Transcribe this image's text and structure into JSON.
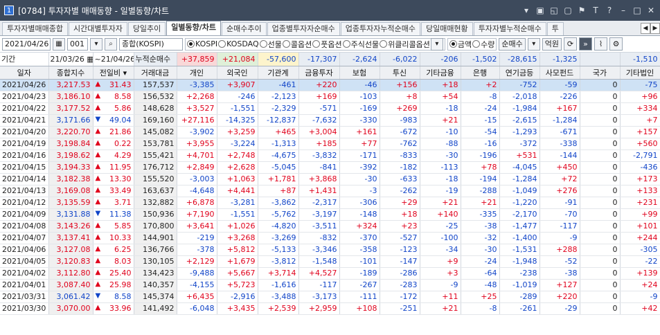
{
  "window": {
    "badge": "1",
    "title": "[0784] 투자자별 매매동향 - 일별동향/차트"
  },
  "tabs": [
    "투자자별매매종합",
    "시간대별투자자",
    "당일추이",
    "일별동향/차트",
    "순매수추이",
    "업종별투자자순매수",
    "업종투자자누적순매수",
    "당일매매현황",
    "투자자별누적순매수",
    "투"
  ],
  "active_tab": 3,
  "toolbar": {
    "date": "2021/04/26",
    "code": "001",
    "market_name": "종합(KOSPI)",
    "market_options": [
      "KOSPI",
      "KOSDAQ",
      "선물",
      "콜옵션",
      "풋옵션",
      "주식선물",
      "위클리콜옵션"
    ],
    "value_options": [
      "금액",
      "수량"
    ],
    "net_buy": "순매수",
    "unit": "억원"
  },
  "period": {
    "label": "기간",
    "from": "21/03/26",
    "sep": "~",
    "to": "21/04/26",
    "sum_label": "누적순매수",
    "sums": [
      "+37,859",
      "+21,084",
      "-57,600",
      "-17,307",
      "-2,624",
      "-6,022",
      "-206",
      "-1,502",
      "-28,615",
      "-1,325",
      "",
      "-1,510"
    ]
  },
  "columns": [
    "일자",
    "종합지수",
    "전일비",
    "거래대금",
    "개인",
    "외국인",
    "기관계",
    "금융투자",
    "보험",
    "투신",
    "기타금융",
    "은행",
    "연기금등",
    "사모펀드",
    "국가",
    "기타법인"
  ],
  "rows": [
    [
      "2021/04/26",
      "3,217.53",
      "up",
      "31.43",
      "157,537",
      "-3,385",
      "+3,907",
      "-461",
      "+220",
      "-46",
      "+156",
      "+18",
      "+2",
      "-752",
      "-59",
      "0",
      "-75"
    ],
    [
      "2021/04/23",
      "3,186.10",
      "up",
      "8.58",
      "156,532",
      "+2,268",
      "-246",
      "-2,123",
      "+169",
      "-103",
      "+8",
      "+54",
      "-8",
      "-2,018",
      "-226",
      "0",
      "+96"
    ],
    [
      "2021/04/22",
      "3,177.52",
      "up",
      "5.86",
      "148,628",
      "+3,527",
      "-1,551",
      "-2,329",
      "-571",
      "-169",
      "+269",
      "-18",
      "-24",
      "-1,984",
      "+167",
      "0",
      "+334"
    ],
    [
      "2021/04/21",
      "3,171.66",
      "dn",
      "49.04",
      "169,160",
      "+27,116",
      "-14,325",
      "-12,837",
      "-7,632",
      "-330",
      "-983",
      "+21",
      "-15",
      "-2,615",
      "-1,284",
      "0",
      "+7"
    ],
    [
      "2021/04/20",
      "3,220.70",
      "up",
      "21.86",
      "145,082",
      "-3,902",
      "+3,259",
      "+465",
      "+3,004",
      "+161",
      "-672",
      "-10",
      "-54",
      "-1,293",
      "-671",
      "0",
      "+157"
    ],
    [
      "2021/04/19",
      "3,198.84",
      "up",
      "0.22",
      "153,781",
      "+3,955",
      "-3,224",
      "-1,313",
      "+185",
      "+77",
      "-762",
      "-88",
      "-16",
      "-372",
      "-338",
      "0",
      "+560"
    ],
    [
      "2021/04/16",
      "3,198.62",
      "up",
      "4.29",
      "155,421",
      "+4,701",
      "+2,748",
      "-4,675",
      "-3,832",
      "-171",
      "-833",
      "-30",
      "-196",
      "+531",
      "-144",
      "0",
      "-2,791"
    ],
    [
      "2021/04/15",
      "3,194.33",
      "up",
      "11.95",
      "176,712",
      "+2,849",
      "+2,628",
      "-5,045",
      "-841",
      "-392",
      "-182",
      "-113",
      "+78",
      "-4,045",
      "+450",
      "0",
      "-436"
    ],
    [
      "2021/04/14",
      "3,182.38",
      "up",
      "13.30",
      "155,520",
      "-3,003",
      "+1,063",
      "+1,781",
      "+3,868",
      "-30",
      "-633",
      "-18",
      "-194",
      "-1,284",
      "+72",
      "0",
      "+173"
    ],
    [
      "2021/04/13",
      "3,169.08",
      "up",
      "33.49",
      "163,637",
      "-4,648",
      "+4,441",
      "+87",
      "+1,431",
      "-3",
      "-262",
      "-19",
      "-288",
      "-1,049",
      "+276",
      "0",
      "+133"
    ],
    [
      "2021/04/12",
      "3,135.59",
      "up",
      "3.71",
      "132,882",
      "+6,878",
      "-3,281",
      "-3,862",
      "-2,317",
      "-306",
      "+29",
      "+21",
      "+21",
      "-1,220",
      "-91",
      "0",
      "+231"
    ],
    [
      "2021/04/09",
      "3,131.88",
      "dn",
      "11.38",
      "150,936",
      "+7,190",
      "-1,551",
      "-5,762",
      "-3,197",
      "-148",
      "+18",
      "+140",
      "-335",
      "-2,170",
      "-70",
      "0",
      "+99"
    ],
    [
      "2021/04/08",
      "3,143.26",
      "up",
      "5.85",
      "170,800",
      "+3,641",
      "+1,026",
      "-4,820",
      "-3,511",
      "+324",
      "+23",
      "-25",
      "-38",
      "-1,477",
      "-117",
      "0",
      "+101"
    ],
    [
      "2021/04/07",
      "3,137.41",
      "up",
      "10.33",
      "144,901",
      "-219",
      "+3,268",
      "-3,269",
      "-832",
      "-370",
      "-527",
      "-100",
      "-32",
      "-1,400",
      "-9",
      "0",
      "+244"
    ],
    [
      "2021/04/06",
      "3,127.08",
      "up",
      "6.25",
      "136,766",
      "-378",
      "+5,812",
      "-5,133",
      "-3,346",
      "-358",
      "-123",
      "-34",
      "-30",
      "-1,531",
      "+288",
      "0",
      "-305"
    ],
    [
      "2021/04/05",
      "3,120.83",
      "up",
      "8.03",
      "130,105",
      "+2,129",
      "+1,679",
      "-3,812",
      "-1,548",
      "-101",
      "-147",
      "+9",
      "-24",
      "-1,948",
      "-52",
      "0",
      "-22"
    ],
    [
      "2021/04/02",
      "3,112.80",
      "up",
      "25.40",
      "134,423",
      "-9,488",
      "+5,667",
      "+3,714",
      "+4,527",
      "-189",
      "-286",
      "+3",
      "-64",
      "-238",
      "-38",
      "0",
      "+139"
    ],
    [
      "2021/04/01",
      "3,087.40",
      "up",
      "25.98",
      "140,357",
      "-4,155",
      "+5,723",
      "-1,616",
      "-117",
      "-267",
      "-283",
      "-9",
      "-48",
      "-1,019",
      "+127",
      "0",
      "+24"
    ],
    [
      "2021/03/31",
      "3,061.42",
      "dn",
      "8.58",
      "145,374",
      "+6,435",
      "-2,916",
      "-3,488",
      "-3,173",
      "-111",
      "-172",
      "+11",
      "+25",
      "-289",
      "+220",
      "0",
      "-9"
    ],
    [
      "2021/03/30",
      "3,070.00",
      "up",
      "33.96",
      "141,492",
      "-6,048",
      "+3,435",
      "+2,539",
      "+2,959",
      "+108",
      "-251",
      "+21",
      "-8",
      "-261",
      "-29",
      "0",
      "+42"
    ]
  ],
  "colors": {
    "up": "#e0001b",
    "down": "#1044c8",
    "selected_row": "#cfe2f5"
  }
}
